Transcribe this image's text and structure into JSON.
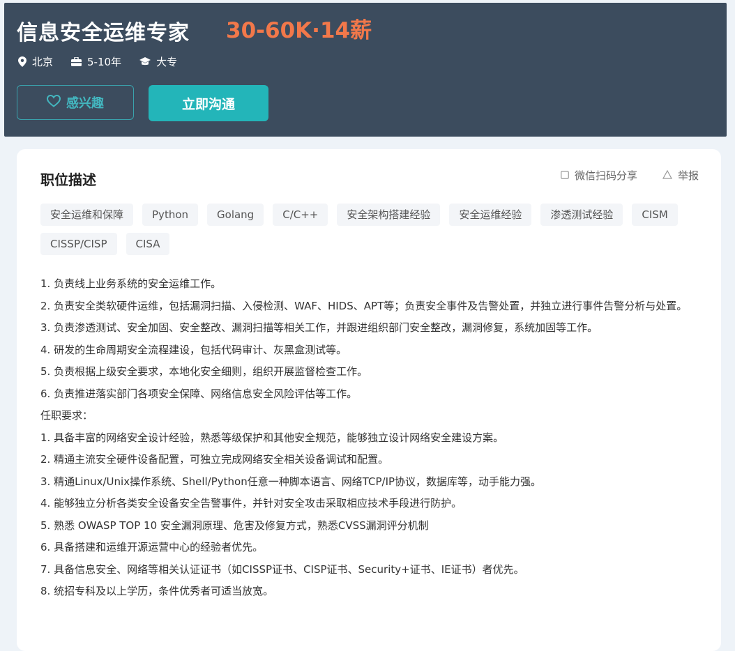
{
  "job": {
    "title": "信息安全运维专家",
    "salary": "30-60K·14薪",
    "location": "北京",
    "experience": "5-10年",
    "education": "大专"
  },
  "buttons": {
    "interest": "感兴趣",
    "chat": "立即沟通"
  },
  "card": {
    "section_title": "职位描述",
    "share_label": "微信扫码分享",
    "report_label": "举报"
  },
  "tags": [
    "安全运维和保障",
    "Python",
    "Golang",
    "C/C++",
    "安全架构搭建经验",
    "安全运维经验",
    "渗透测试经验",
    "CISM",
    "CISSP/CISP",
    "CISA"
  ],
  "description": [
    "1. 负责线上业务系统的安全运维工作。",
    "2. 负责安全类软硬件运维，包括漏洞扫描、入侵检测、WAF、HIDS、APT等；负责安全事件及告警处置，并独立进行事件告警分析与处置。",
    "3. 负责渗透测试、安全加固、安全整改、漏洞扫描等相关工作，并跟进组织部门安全整改，漏洞修复，系统加固等工作。",
    "4. 研发的生命周期安全流程建设，包括代码审计、灰黑盒测试等。",
    "5. 负责根据上级安全要求，本地化安全细则，组织开展监督检查工作。",
    "6. 负责推进落实部门各项安全保障、网络信息安全风险评估等工作。",
    "任职要求：",
    "1. 具备丰富的网络安全设计经验，熟悉等级保护和其他安全规范，能够独立设计网络安全建设方案。",
    "2. 精通主流安全硬件设备配置，可独立完成网络安全相关设备调试和配置。",
    "3. 精通Linux/Unix操作系统、Shell/Python任意一种脚本语言、网络TCP/IP协议，数据库等，动手能力强。",
    "4. 能够独立分析各类安全设备安全告警事件，并针对安全攻击采取相应技术手段进行防护。",
    "5. 熟悉 OWASP TOP 10 安全漏洞原理、危害及修复方式，熟悉CVSS漏洞评分机制",
    "6. 具备搭建和运维开源运营中心的经验者优先。",
    "7. 具备信息安全、网络等相关认证证书（如CISSP证书、CISP证书、Security+证书、IE证书）者优先。",
    "8. 统招专科及以上学历，条件优秀者可适当放宽。"
  ],
  "colors": {
    "header_bg": "#3c4c5e",
    "salary": "#f2784a",
    "accent": "#23b5b9"
  }
}
